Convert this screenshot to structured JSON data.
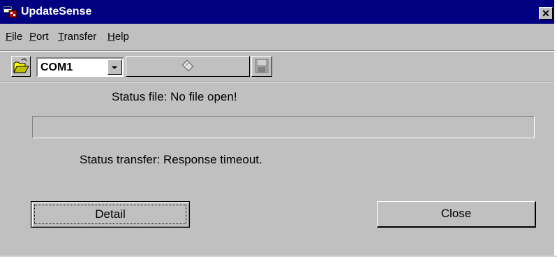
{
  "window": {
    "title": "UpdateSense",
    "close_glyph": "✕"
  },
  "menu": [
    {
      "accel": "F",
      "rest": "ile"
    },
    {
      "accel": "P",
      "rest": "ort"
    },
    {
      "accel": "T",
      "rest": "ransfer"
    },
    {
      "accel": "H",
      "rest": "elp"
    }
  ],
  "toolbar": {
    "open_icon": "folder-open-icon",
    "port_value": "COM1",
    "transfer_icon": "transfer-tape-icon",
    "save_icon": "floppy-disk-icon"
  },
  "status": {
    "file_text": "Status file:  No file open!",
    "transfer_text": "Status transfer:  Response timeout.",
    "progress": 0
  },
  "buttons": {
    "detail": "Detail",
    "close": "Close"
  },
  "colors": {
    "titlebar": "#000080",
    "face": "#c0c0c0"
  }
}
